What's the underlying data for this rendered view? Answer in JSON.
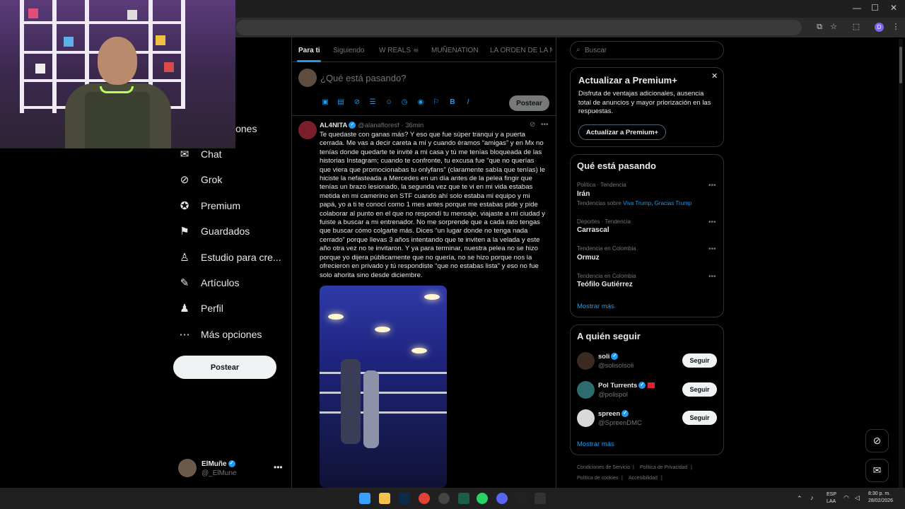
{
  "browser": {
    "profile_initial": "D"
  },
  "tabs": [
    {
      "label": "Para ti",
      "active": true
    },
    {
      "label": "Siguiendo",
      "active": false
    },
    {
      "label": "W REALS ☠",
      "active": false
    },
    {
      "label": "MUÑENATION",
      "active": false
    },
    {
      "label": "LA ORDEN DE LA M",
      "active": false
    }
  ],
  "nav": {
    "partial_label": "iones",
    "items": [
      {
        "label": "Chat",
        "icon": "mail-icon"
      },
      {
        "label": "Grok",
        "icon": "grok-icon"
      },
      {
        "label": "Premium",
        "icon": "premium-icon"
      },
      {
        "label": "Guardados",
        "icon": "bookmark-icon"
      },
      {
        "label": "Estudio para cre...",
        "icon": "studio-icon"
      },
      {
        "label": "Artículos",
        "icon": "articles-icon"
      },
      {
        "label": "Perfil",
        "icon": "profile-icon"
      },
      {
        "label": "Más opciones",
        "icon": "more-icon"
      }
    ],
    "post_button": "Postear"
  },
  "account": {
    "name": "ElMuñe",
    "handle": "@_ElMune"
  },
  "compose": {
    "placeholder": "¿Qué está pasando?",
    "post_button": "Postear"
  },
  "tweet": {
    "name": "AL4NITA",
    "handle": "@alanafloresf",
    "time": "· 36min",
    "text": "Te quedaste con ganas más? Y eso que fue súper tranqui y a puerta cerrada. Me vas a decir careta a mí y cuando éramos “amigas” y en Mx no tenías donde quedarte te invité a mi casa y tú me tenías bloqueada de las historias Instagram; cuando te confronte, tu excusa fue “que no querías que viera que promocionabas tu onlyfans” (claramente sabía que tenías) le hiciste la nefasteada a Mercedes en un día antes de la pelea fingir que tenías un brazo lesionado, la segunda vez que te vi en mi vida estabas metida en mi camerino en STF cuando ahí solo estaba mi equipo y mi papá, yo a ti te conocí como 1 mes antes porque me estabas pide y pide colaborar al punto en el que no respondí tu mensaje, viajaste a mi ciudad y fuiste a buscar a mi entrenador. No me sorprende que a cada rato tengas que buscar cómo colgarte más. Dices “un lugar donde no tenga nada cerrado” porque llevas 3 años intentando que te inviten a la velada y este año otra vez no te invitaron. Y ya para terminar, nuestra pelea no se hizo porque yo dijera públicamente que no quería, no se hizo porque nos la ofrecieron en privado y tú respondiste “que no estabas lista” y eso no fue solo ahorita sino desde diciembre."
  },
  "search": {
    "placeholder": "Buscar"
  },
  "premium": {
    "title": "Actualizar a Premium+",
    "description": "Disfruta de ventajas adicionales, ausencia total de anuncios y mayor priorización en las respuestas.",
    "button": "Actualizar a Premium+"
  },
  "trends": {
    "title": "Qué está pasando",
    "items": [
      {
        "meta": "Política · Tendencia",
        "name": "Irán",
        "extra_prefix": "Tendencias sobre ",
        "extra_links": "Viva Trump, Gracias Trump"
      },
      {
        "meta": "Deportes · Tendencia",
        "name": "Carrascal"
      },
      {
        "meta": "Tendencia en Colombia",
        "name": "Ormuz"
      },
      {
        "meta": "Tendencia en Colombia",
        "name": "Teófilo Gutiérrez"
      }
    ],
    "show_more": "Mostrar más"
  },
  "follow": {
    "title": "A quién seguir",
    "items": [
      {
        "name": "soli",
        "handle": "@solisolsoli",
        "button": "Seguir"
      },
      {
        "name": "Pol Turrents",
        "handle": "@polispol",
        "button": "Seguir"
      },
      {
        "name": "spreen",
        "handle": "@SpreenDMC",
        "button": "Seguir"
      }
    ],
    "show_more": "Mostrar más"
  },
  "footer": {
    "links": [
      "Condiciones de Servicio",
      "|",
      "Política de Privacidad",
      "|",
      "Política de cookies",
      "|",
      "Accesibilidad",
      "|"
    ]
  },
  "taskbar": {
    "lang_top": "ESP",
    "lang_bottom": "LAA",
    "time": "8:30 p. m.",
    "date": "28/02/2026"
  },
  "colors": {
    "accent": "#1d9bf0",
    "background": "#000000"
  }
}
